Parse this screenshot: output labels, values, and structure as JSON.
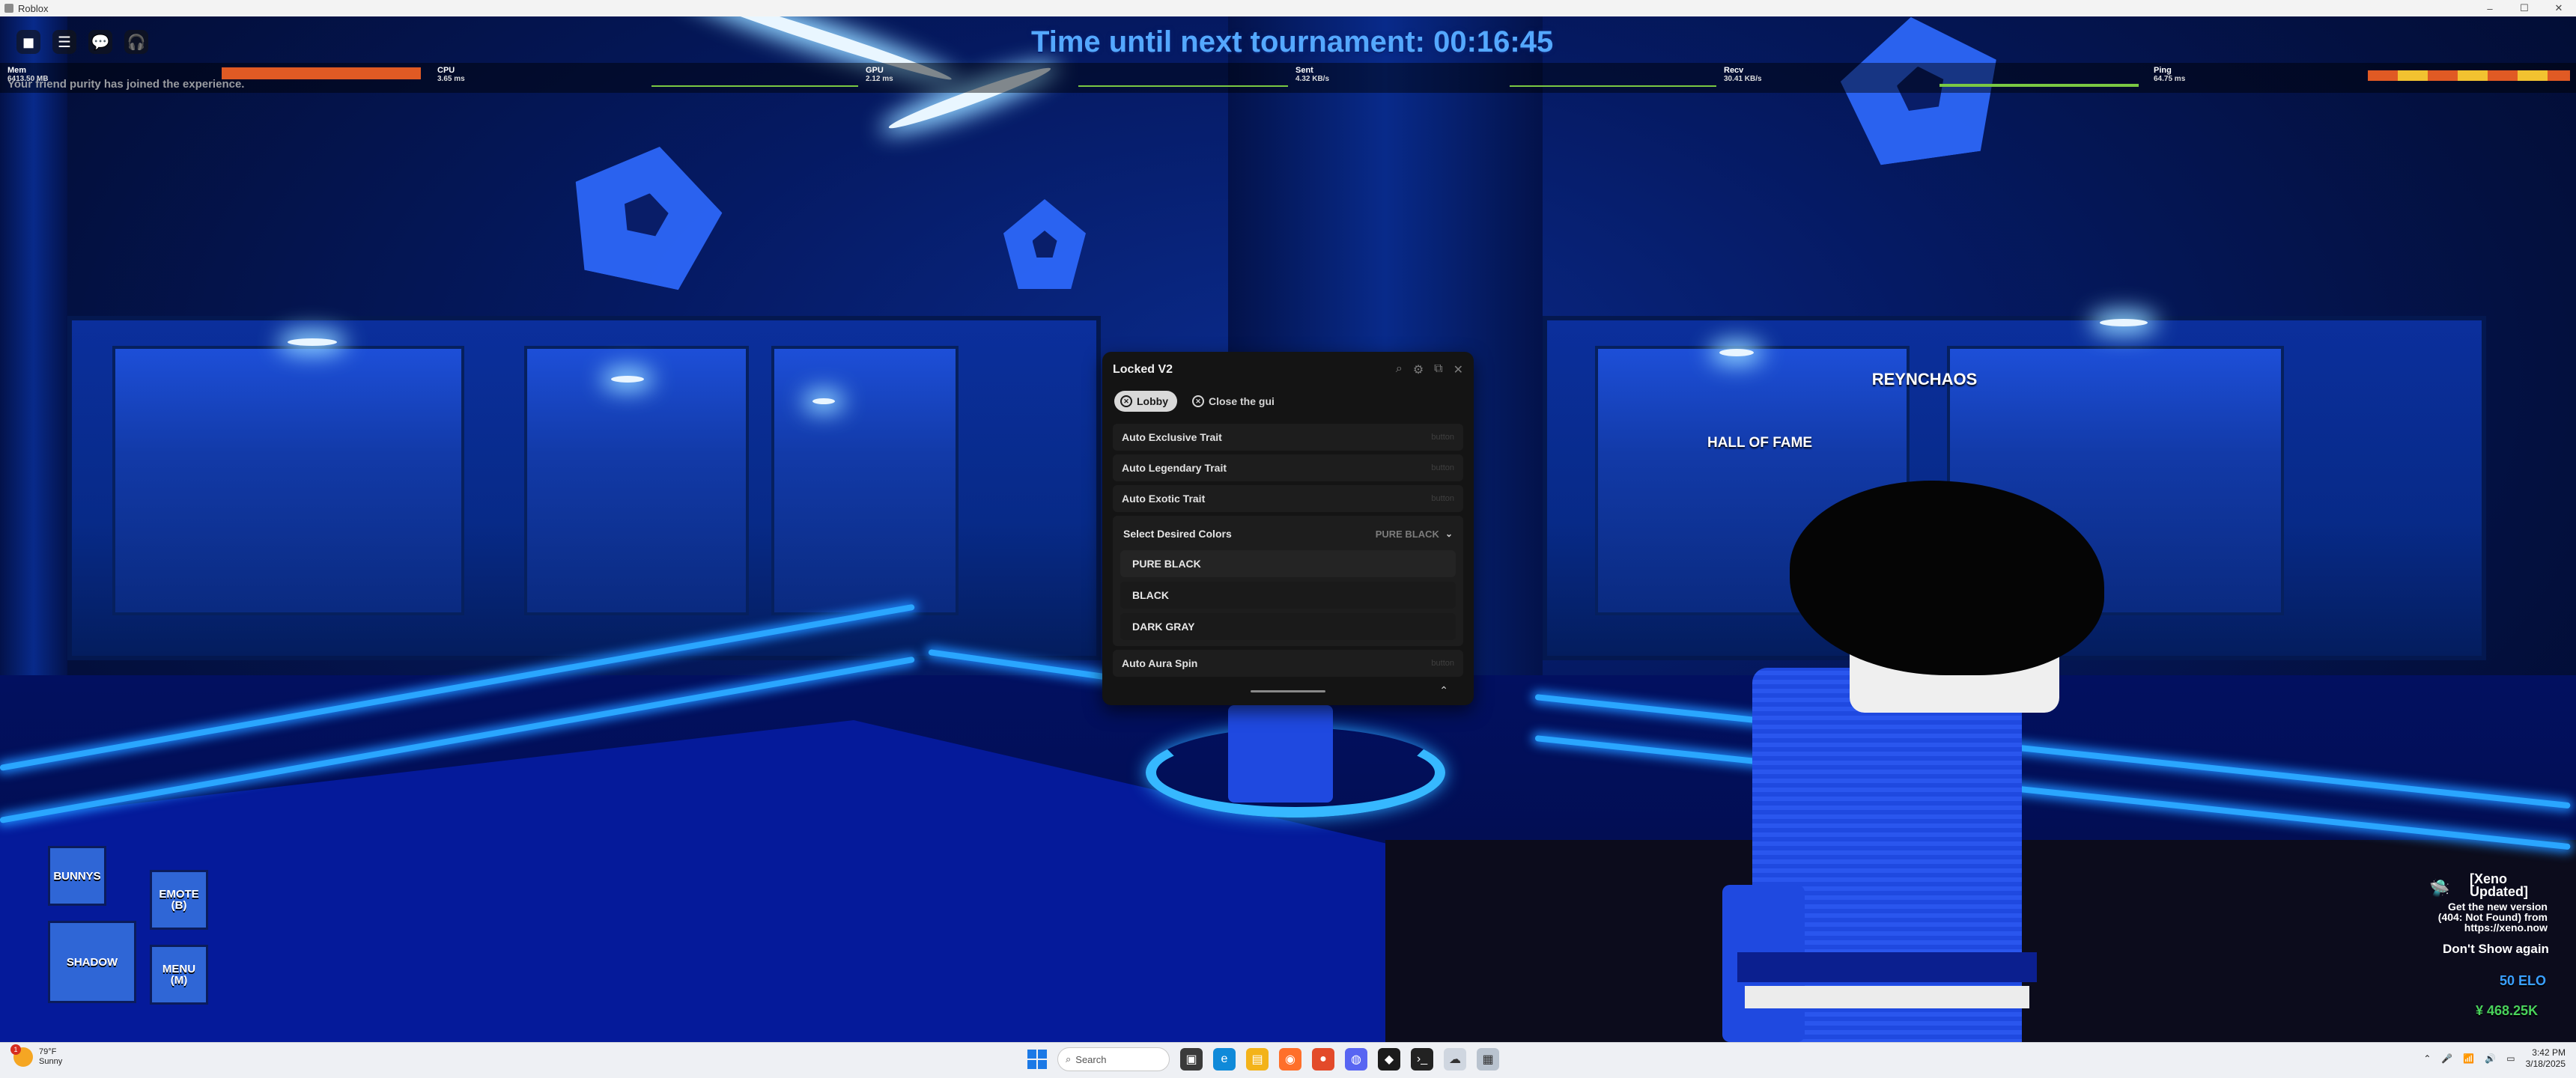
{
  "window": {
    "title": "Roblox",
    "controls": [
      "–",
      "☐",
      "✕"
    ]
  },
  "hud": {
    "timer": "Time until next tournament: 00:16:45",
    "join_message": "Your friend purity has joined the experience.",
    "icons": [
      "roblox-logo-icon",
      "hamburger-menu-icon",
      "chat-icon",
      "headset-icon"
    ],
    "stats": {
      "mem_label": "Mem",
      "mem_value": "6413.50 MB",
      "cpu_label": "CPU",
      "cpu_value": "3.65 ms",
      "gpu_label": "GPU",
      "gpu_value": "2.12 ms",
      "sent_label": "Sent",
      "sent_value": "4.32 KB/s",
      "recv_label": "Recv",
      "recv_value": "30.41 KB/s",
      "ping_label": "Ping",
      "ping_value": "64.75 ms"
    }
  },
  "world": {
    "hall_of_fame": "HALL OF FAME",
    "player_name": "REYNCHAOS"
  },
  "gui": {
    "title": "Locked V2",
    "tools": [
      "search-icon",
      "sliders-icon",
      "resize-icon",
      "close-icon"
    ],
    "tabs": [
      {
        "label": "Lobby",
        "active": true
      },
      {
        "label": "Close the gui",
        "active": false
      }
    ],
    "toggles": [
      {
        "label": "Auto Exclusive Trait",
        "tag": "button"
      },
      {
        "label": "Auto Legendary Trait",
        "tag": "button"
      },
      {
        "label": "Auto Exotic Trait",
        "tag": "button"
      }
    ],
    "dropdown": {
      "label": "Select Desired Colors",
      "selected": "PURE BLACK",
      "options": [
        "PURE BLACK",
        "BLACK",
        "DARK GRAY"
      ]
    },
    "after_toggles": [
      {
        "label": "Auto Aura Spin",
        "tag": "button"
      }
    ]
  },
  "buttons": {
    "bunnys": "BUNNYS",
    "emote": "EMOTE\n(B)",
    "shadow": "SHADOW",
    "menu": "MENU\n(M)"
  },
  "notification": {
    "title": "[Xeno Updated]",
    "body": "Get the new version (404: Not Found) from https://xeno.now",
    "dismiss": "Don't Show again"
  },
  "currency": {
    "elo": "50 ELO",
    "money": "¥ 468.25K"
  },
  "taskbar": {
    "weather_temp": "79°F",
    "weather_desc": "Sunny",
    "weather_badge": "1",
    "search_placeholder": "Search",
    "time": "3:42 PM",
    "date": "3/18/2025"
  },
  "colors": {
    "accent_blue": "#54a8ff",
    "gui_bg": "#141414",
    "button_blue": "#2f66d6",
    "elo_blue": "#3aa0ff",
    "money_green": "#49d25b"
  }
}
